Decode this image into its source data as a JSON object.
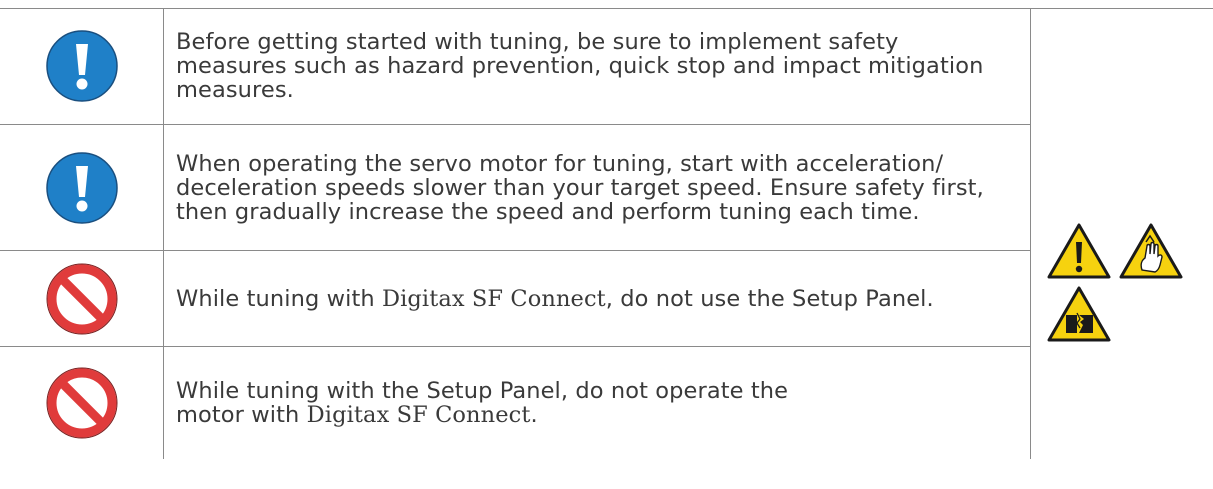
{
  "rows": [
    {
      "icon": "mandatory-action-icon",
      "text": "Before getting started with tuning, be sure to implement safety measures such as hazard prevention, quick stop and impact mitigation measures."
    },
    {
      "icon": "mandatory-action-icon",
      "text": "When operating the servo motor for tuning, start with acceleration/ deceleration speeds slower than your target speed. Ensure safety first, then gradually increase the speed and perform tuning each time."
    },
    {
      "icon": "prohibition-icon",
      "text_before": "While tuning with ",
      "product": "Digitax SF Connect",
      "text_after": ", do not use the Setup Panel."
    },
    {
      "icon": "prohibition-icon",
      "text_before": "While tuning with the Setup Panel, do not operate the motor with ",
      "product": "Digitax SF Connect",
      "text_after": "."
    }
  ],
  "hazard_symbols": [
    "general-warning-icon",
    "pinch-hazard-icon",
    "impact-hazard-icon"
  ],
  "colors": {
    "mandatory_blue": "#1f80c8",
    "prohibition_red": "#e03b3b",
    "warning_yellow": "#f6d20f",
    "rule": "#8a8a8a",
    "text": "#3a3a3a"
  }
}
